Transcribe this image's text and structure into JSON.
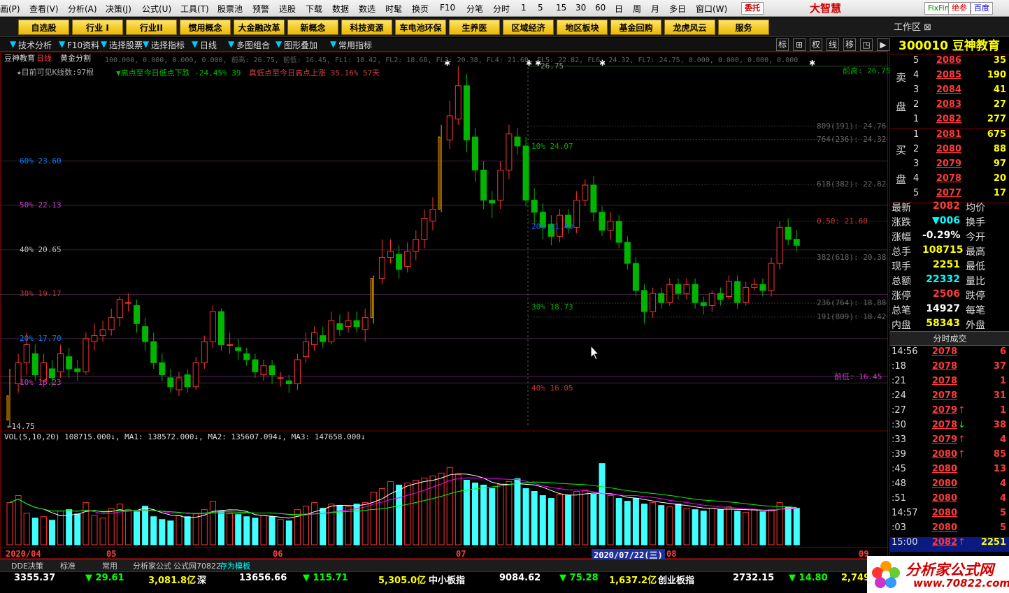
{
  "menu": {
    "items": [
      "画(P)",
      "查看(V)",
      "分析(A)",
      "决策(J)",
      "公式(U)",
      "工具(T)",
      "股票池",
      "预警",
      "选股",
      "下载",
      "数据",
      "数选",
      "时髦",
      "换页",
      "F10",
      "分笔",
      "分时",
      "1",
      "5",
      "15",
      "30",
      "60",
      "日",
      "周",
      "月",
      "多日",
      "窗口(W)"
    ],
    "right": {
      "entrust": "委托",
      "brand": "大智慧",
      "fixfin": "FixFin",
      "jueshen": "绝参",
      "baidu": "百度"
    }
  },
  "categories": [
    "自选股",
    "行业 I",
    "行业II",
    "惯用概念",
    "大金融改革",
    "新概念",
    "科技资源",
    "车电池环保",
    "生养医",
    "区域经济",
    "地区板块",
    "基金回购",
    "龙虎风云",
    "服务"
  ],
  "workzone": "工作区",
  "toolbar": {
    "items": [
      "技术分析",
      "F10资料",
      "选择股票",
      "选择指标",
      "日线",
      "多图组合",
      "图形叠加",
      "常用指标"
    ],
    "right": [
      "标",
      "⊞",
      "权",
      "线",
      "移",
      "◳",
      "▶"
    ]
  },
  "chart": {
    "title": "豆神教育",
    "period": "日线",
    "overlay": "黄金分割",
    "indicator_line": "100.000, 0.000, 0.000, 0.000, 前高: 26.75, 前低: 16.45, FL1: 18.42, FL2: 18.68, FL3: 20.38, FL4: 21.60, FL5: 22.82, FL6: 24.32, FL7: 24.75, 0.000, 0.000, 0.000, 0.000",
    "visible_k": "★目前可见K线数:97根",
    "info2": "▼高点至今日低点下跌 -24.45% 39",
    "info3": "真低点至今日高点上涨 35.16% 57天",
    "low_label": "←14.75",
    "high_label": "26.75",
    "pct_left": [
      {
        "t": "60% 23.60"
      },
      {
        "t": "50% 22.13"
      },
      {
        "t": "40% 20.65"
      },
      {
        "t": "30% 19.17"
      },
      {
        "t": "20% 17.70"
      },
      {
        "t": "10% 16.23"
      }
    ],
    "pct_mid": [
      {
        "t": "10% 24.07"
      },
      {
        "t": "20% 21.40"
      },
      {
        "t": "30% 18.73"
      },
      {
        "t": "40% 16.05"
      }
    ],
    "fib_right": [
      {
        "t": "809(191): 24.76"
      },
      {
        "t": "764(236): 24.32"
      },
      {
        "t": "618(382): 22.82"
      },
      {
        "t": "0.50: 21.60"
      },
      {
        "t": "382(618): 20.38"
      },
      {
        "t": "236(764): 18.88"
      },
      {
        "t": "191(809): 18.42"
      }
    ],
    "prev_high": "前高: 26.75",
    "prev_low": "前低: 16.45"
  },
  "volume": {
    "legend": "VOL(5,10,20) 108715.000↓, MA1: 138572.000↓, MA2: 135607.094↓, MA3: 147658.000↓"
  },
  "xaxis": {
    "labels": [
      "2020/04",
      "05",
      "06",
      "07",
      "2020/07/22(三)",
      "08",
      "09"
    ]
  },
  "stock": {
    "code": "300010",
    "name": "豆神教育"
  },
  "orderbook": {
    "sell_label": [
      "卖",
      "盘"
    ],
    "buy_label": [
      "买",
      "盘"
    ],
    "sell": [
      {
        "lv": "5",
        "p": "2086",
        "v": "35"
      },
      {
        "lv": "4",
        "p": "2085",
        "v": "190"
      },
      {
        "lv": "3",
        "p": "2084",
        "v": "41"
      },
      {
        "lv": "2",
        "p": "2083",
        "v": "27"
      },
      {
        "lv": "1",
        "p": "2082",
        "v": "277"
      }
    ],
    "buy": [
      {
        "lv": "1",
        "p": "2081",
        "v": "675"
      },
      {
        "lv": "2",
        "p": "2080",
        "v": "88"
      },
      {
        "lv": "3",
        "p": "2079",
        "v": "97"
      },
      {
        "lv": "4",
        "p": "2078",
        "v": "20"
      },
      {
        "lv": "5",
        "p": "2077",
        "v": "17"
      }
    ]
  },
  "stats": [
    {
      "k": "最新",
      "v": "2082",
      "c": "#ff3b3b",
      "k2": "均价"
    },
    {
      "k": "涨跌",
      "v": "▼006",
      "c": "#00ffff",
      "k2": "换手"
    },
    {
      "k": "涨幅",
      "v": "-0.29%",
      "c": "#ffffff",
      "k2": "今开"
    },
    {
      "k": "总手",
      "v": "108715",
      "c": "#ffff00",
      "k2": "最高"
    },
    {
      "k": "现手",
      "v": "2251",
      "c": "#ffff00",
      "k2": "最低"
    },
    {
      "k": "总额",
      "v": "22332",
      "c": "#00ffff",
      "k2": "量比"
    },
    {
      "k": "涨停",
      "v": "2506",
      "c": "#ff3b3b",
      "k2": "跌停"
    },
    {
      "k": "总笔",
      "v": "14927",
      "c": "#ffffff",
      "k2": "每笔"
    },
    {
      "k": "内盘",
      "v": "58343",
      "c": "#ffff00",
      "k2": "外盘"
    }
  ],
  "timesales": {
    "title": "分时成交",
    "rows": [
      {
        "t": "14:56",
        "p": "2078",
        "a": "",
        "q": "6"
      },
      {
        "t": ":18",
        "p": "2078",
        "a": "",
        "q": "37"
      },
      {
        "t": ":21",
        "p": "2078",
        "a": "",
        "q": "1"
      },
      {
        "t": ":24",
        "p": "2078",
        "a": "",
        "q": "31"
      },
      {
        "t": ":27",
        "p": "2079",
        "a": "↑",
        "q": "1"
      },
      {
        "t": ":30",
        "p": "2078",
        "a": "↓",
        "q": "38"
      },
      {
        "t": ":33",
        "p": "2079",
        "a": "↑",
        "q": "4"
      },
      {
        "t": ":39",
        "p": "2080",
        "a": "↑",
        "q": "85"
      },
      {
        "t": ":45",
        "p": "2080",
        "a": "",
        "q": "13"
      },
      {
        "t": ":48",
        "p": "2080",
        "a": "",
        "q": "4"
      },
      {
        "t": ":51",
        "p": "2080",
        "a": "",
        "q": "4"
      },
      {
        "t": "14:57",
        "p": "2080",
        "a": "",
        "q": "5"
      },
      {
        "t": ":03",
        "p": "2080",
        "a": "",
        "q": "5"
      },
      {
        "t": "15:00",
        "p": "2082",
        "a": "↑",
        "q": "2251"
      }
    ]
  },
  "tabs": [
    "DDE决策",
    "标准",
    "常用",
    "分析家公式",
    "公式网70822",
    "存为模板"
  ],
  "ticker": [
    {
      "t": "3355.37",
      "c": "#ffffff"
    },
    {
      "t": "▼ 29.61",
      "c": "#00ff00"
    },
    {
      "t": "3,081.8亿",
      "c": "#ffff00"
    },
    {
      "t": "深",
      "c": "#ffffff"
    },
    {
      "t": "13656.66",
      "c": "#ffffff"
    },
    {
      "t": "▼ 115.71",
      "c": "#00ff00"
    },
    {
      "t": "5,305.0亿",
      "c": "#ffff00"
    },
    {
      "t": "中小板指",
      "c": "#ffffff"
    },
    {
      "t": "9084.62",
      "c": "#ffffff"
    },
    {
      "t": "▼ 75.28",
      "c": "#00ff00"
    },
    {
      "t": "1,637.2亿",
      "c": "#ffff00"
    },
    {
      "t": "创业板指",
      "c": "#ffffff"
    },
    {
      "t": "2732.15",
      "c": "#ffffff"
    },
    {
      "t": "▼ 14.80",
      "c": "#00ff00"
    },
    {
      "t": "2,749.",
      "c": "#ffff00"
    }
  ],
  "logo": {
    "name": "分析家公式网",
    "url": "www.70822.com"
  }
}
